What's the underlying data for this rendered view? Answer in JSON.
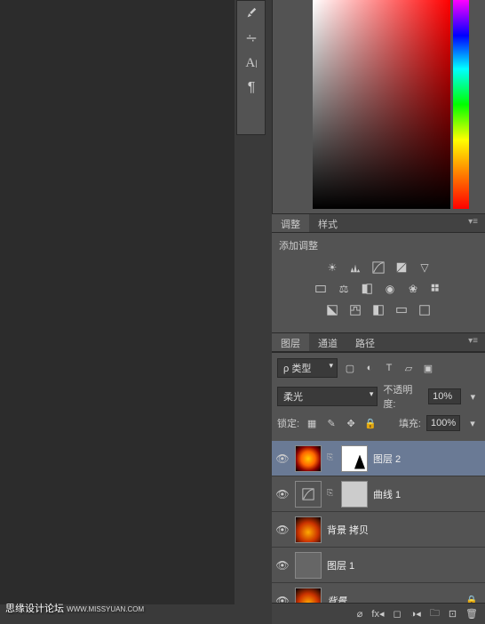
{
  "toolbar": {
    "icons": [
      "brush-icon",
      "slider-icon",
      "text-icon",
      "paragraph-icon"
    ]
  },
  "adjustments": {
    "tab1": "调整",
    "tab2": "样式",
    "add_label": "添加调整"
  },
  "layers_tabs": {
    "t1": "图层",
    "t2": "通道",
    "t3": "路径"
  },
  "properties": {
    "kind_label": "类型",
    "blend_mode": "柔光",
    "opacity_label": "不透明度:",
    "opacity_value": "10%",
    "lock_label": "锁定:",
    "fill_label": "填充:",
    "fill_value": "100%"
  },
  "layers": [
    {
      "name": "图层 2",
      "thumb": "fire",
      "mask": true,
      "selected": true
    },
    {
      "name": "曲线 1",
      "thumb": "adj",
      "mask_grey": true
    },
    {
      "name": "背景 拷贝",
      "thumb": "fire2"
    },
    {
      "name": "图层 1",
      "thumb": "grey"
    },
    {
      "name": "背景",
      "thumb": "fire2",
      "italic": true,
      "locked": true
    }
  ],
  "watermark": {
    "main": "思缘设计论坛",
    "sub": "WWW.MISSYUAN.COM"
  }
}
